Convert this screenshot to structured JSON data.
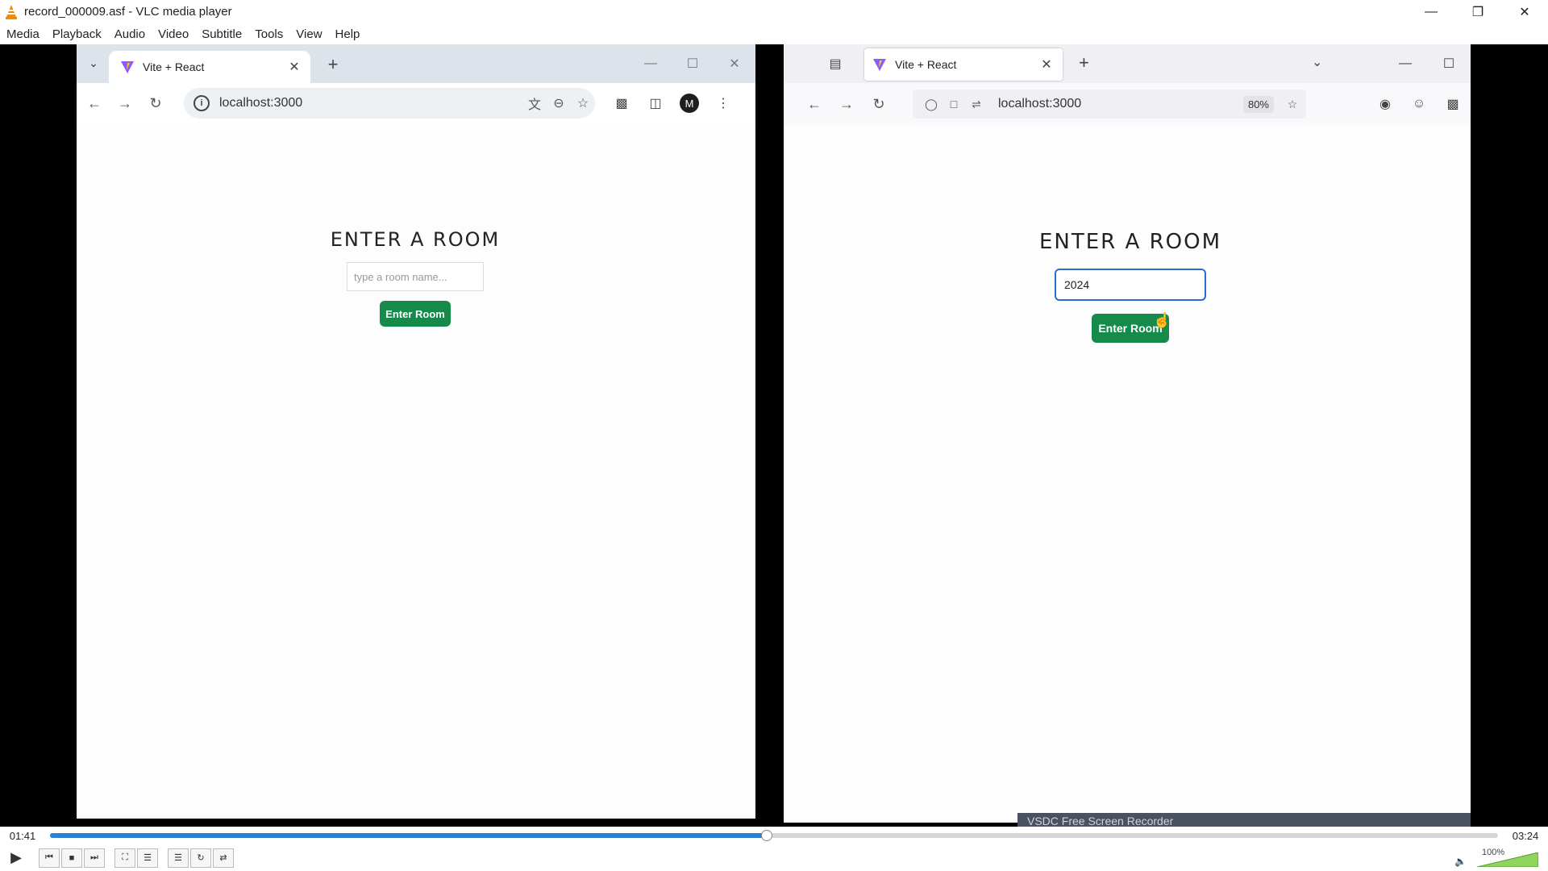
{
  "vlc": {
    "title": "record_000009.asf - VLC media player",
    "menu": [
      "Media",
      "Playback",
      "Audio",
      "Video",
      "Subtitle",
      "Tools",
      "View",
      "Help"
    ],
    "elapsed": "01:41",
    "total": "03:24",
    "progress": 0.495,
    "volume": "100%"
  },
  "chrome": {
    "tab_title": "Vite + React",
    "url": "localhost:3000",
    "avatar_letter": "M"
  },
  "firefox": {
    "tab_title": "Vite + React",
    "url": "localhost:3000",
    "zoom": "80%"
  },
  "left_page": {
    "title": "ENTER A ROOM",
    "input_placeholder": "type a room name...",
    "button_label": "Enter Room"
  },
  "right_page": {
    "title": "ENTER A ROOM",
    "input_value": "2024",
    "button_label": "Enter Room"
  },
  "watermark": "VSDC Free Screen Recorder",
  "colors": {
    "button_green": "#168a4a",
    "seek_blue": "#2d7fd3",
    "focus_blue": "#2a6dd1"
  }
}
